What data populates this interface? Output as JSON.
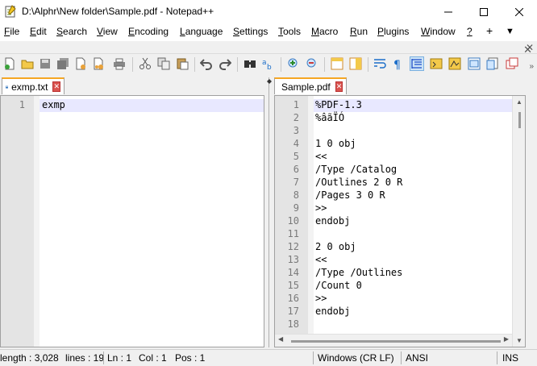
{
  "window": {
    "title": "D:\\Alphr\\New folder\\Sample.pdf - Notepad++"
  },
  "menu": {
    "items": [
      {
        "label": "File",
        "u": "F",
        "rest": "ile"
      },
      {
        "label": "Edit",
        "u": "E",
        "rest": "dit"
      },
      {
        "label": "Search",
        "u": "S",
        "rest": "earch"
      },
      {
        "label": "View",
        "u": "V",
        "rest": "iew"
      },
      {
        "label": "Encoding",
        "u": "E",
        "rest": "ncoding"
      },
      {
        "label": "Language",
        "u": "L",
        "rest": "anguage"
      },
      {
        "label": "Settings",
        "u": "S",
        "rest": "ettings"
      },
      {
        "label": "Tools",
        "u": "T",
        "rest": "ools"
      },
      {
        "label": "Macro",
        "u": "M",
        "rest": "acro"
      },
      {
        "label": "Run",
        "u": "R",
        "rest": "un"
      },
      {
        "label": "Plugins",
        "u": "P",
        "rest": "lugins"
      },
      {
        "label": "Window",
        "u": "W",
        "rest": "indow"
      },
      {
        "label": "?",
        "u": "?",
        "rest": ""
      }
    ],
    "plus": "+",
    "dropdown": "▼",
    "close": "✕"
  },
  "toolbar": {
    "icons": [
      "new-file-icon",
      "open-file-icon",
      "save-icon",
      "save-all-icon",
      "close-icon",
      "close-all-icon",
      "print-icon",
      "cut-icon",
      "copy-icon",
      "paste-icon",
      "undo-icon",
      "redo-icon",
      "find-icon",
      "replace-icon",
      "zoom-in-icon",
      "zoom-out-icon",
      "sync-vertical-icon",
      "sync-horizontal-icon",
      "word-wrap-icon",
      "show-all-chars-icon",
      "indent-guide-icon",
      "language-icon",
      "doc-map-icon",
      "function-list-icon",
      "folder-workspace-icon",
      "monitoring-icon"
    ],
    "overflow": "»"
  },
  "tabs": {
    "left": {
      "label": "exmp.txt",
      "close": "✕"
    },
    "right": {
      "label": "Sample.pdf",
      "close": "✕"
    }
  },
  "left_editor": {
    "lines": [
      {
        "n": "1",
        "text": "exmp"
      }
    ]
  },
  "right_editor": {
    "lines": [
      {
        "n": "1",
        "text": "%PDF-1.3"
      },
      {
        "n": "2",
        "text": "%âãÏÓ"
      },
      {
        "n": "3",
        "text": ""
      },
      {
        "n": "4",
        "text": "1 0 obj"
      },
      {
        "n": "5",
        "text": "<<"
      },
      {
        "n": "6",
        "text": "/Type /Catalog"
      },
      {
        "n": "7",
        "text": "/Outlines 2 0 R"
      },
      {
        "n": "8",
        "text": "/Pages 3 0 R"
      },
      {
        "n": "9",
        "text": ">>"
      },
      {
        "n": "10",
        "text": "endobj"
      },
      {
        "n": "11",
        "text": ""
      },
      {
        "n": "12",
        "text": "2 0 obj"
      },
      {
        "n": "13",
        "text": "<<"
      },
      {
        "n": "14",
        "text": "/Type /Outlines"
      },
      {
        "n": "15",
        "text": "/Count 0"
      },
      {
        "n": "16",
        "text": ">>"
      },
      {
        "n": "17",
        "text": "endobj"
      },
      {
        "n": "18",
        "text": ""
      }
    ]
  },
  "status": {
    "length": "length : 3,028",
    "lines": "lines : 19",
    "ln": "Ln : 1",
    "col": "Col : 1",
    "pos": "Pos : 1",
    "eol": "Windows (CR LF)",
    "encoding": "ANSI",
    "mode": "INS"
  },
  "colors": {
    "current_line": "#e8e8ff",
    "gutter": "#e4e4e4",
    "tab_accent": "#f5a623",
    "tab_close": "#d9534f"
  }
}
